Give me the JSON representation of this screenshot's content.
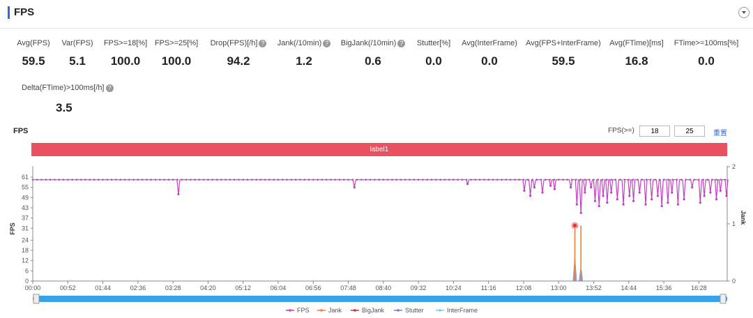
{
  "header": {
    "title": "FPS"
  },
  "stats": [
    {
      "label": "Avg(FPS)",
      "value": "59.5",
      "help": false
    },
    {
      "label": "Var(FPS)",
      "value": "5.1",
      "help": false
    },
    {
      "label": "FPS>=18[%]",
      "value": "100.0",
      "help": false
    },
    {
      "label": "FPS>=25[%]",
      "value": "100.0",
      "help": false
    },
    {
      "label": "Drop(FPS)[/h]",
      "value": "94.2",
      "help": true
    },
    {
      "label": "Jank(/10min)",
      "value": "1.2",
      "help": true
    },
    {
      "label": "BigJank(/10min)",
      "value": "0.6",
      "help": true
    },
    {
      "label": "Stutter[%]",
      "value": "0.0",
      "help": false
    },
    {
      "label": "Avg(InterFrame)",
      "value": "0.0",
      "help": false
    },
    {
      "label": "Avg(FPS+InterFrame)",
      "value": "59.5",
      "help": false
    },
    {
      "label": "Avg(FTime)[ms]",
      "value": "16.8",
      "help": false
    },
    {
      "label": "FTime>=100ms[%]",
      "value": "0.0",
      "help": false
    },
    {
      "label": "Delta(FTime)>100ms[/h]",
      "value": "3.5",
      "help": true
    }
  ],
  "help_glyph": "?",
  "threshold": {
    "label": "FPS(>=)",
    "value1": "18",
    "value2": "25",
    "reset": "重置"
  },
  "label_band": "label1",
  "colors": {
    "fps": "#c23fc2",
    "jank": "#f08030",
    "bigjank": "#c03040",
    "stutter": "#6a86d8",
    "interframe": "#7ec8e8",
    "band": "#e8515f",
    "slider": "#3aa0e8"
  },
  "chart_data": {
    "type": "line",
    "title": "FPS",
    "ylabel": "FPS",
    "y2label": "Jank",
    "ylim": [
      0,
      61
    ],
    "y2lim": [
      0,
      2
    ],
    "yticks": [
      "0",
      "6",
      "12",
      "18",
      "24",
      "31",
      "37",
      "43",
      "49",
      "55",
      "61"
    ],
    "y2ticks": [
      "0",
      "1",
      "2"
    ],
    "xlim_minutes": [
      0,
      1030
    ],
    "xticks": [
      "00:00",
      "00:52",
      "01:44",
      "02:36",
      "03:28",
      "04:20",
      "05:12",
      "06:04",
      "06:56",
      "07:48",
      "08:40",
      "09:32",
      "10:24",
      "11:16",
      "12:08",
      "13:00",
      "13:52",
      "14:44",
      "15:36",
      "16:28"
    ],
    "fps_baseline": 59.5,
    "fps_dips": [
      {
        "x": 3.6,
        "y": 51
      },
      {
        "x": 7.95,
        "y": 55
      },
      {
        "x": 10.75,
        "y": 57
      },
      {
        "x": 12.15,
        "y": 53
      },
      {
        "x": 12.3,
        "y": 50
      },
      {
        "x": 12.4,
        "y": 55
      },
      {
        "x": 12.6,
        "y": 52
      },
      {
        "x": 12.8,
        "y": 56
      },
      {
        "x": 12.9,
        "y": 54
      },
      {
        "x": 13.3,
        "y": 55
      },
      {
        "x": 13.45,
        "y": 45
      },
      {
        "x": 13.55,
        "y": 40
      },
      {
        "x": 13.65,
        "y": 52
      },
      {
        "x": 13.8,
        "y": 55
      },
      {
        "x": 13.9,
        "y": 47
      },
      {
        "x": 14.0,
        "y": 44
      },
      {
        "x": 14.1,
        "y": 50
      },
      {
        "x": 14.2,
        "y": 46
      },
      {
        "x": 14.3,
        "y": 52
      },
      {
        "x": 14.45,
        "y": 48
      },
      {
        "x": 14.6,
        "y": 45
      },
      {
        "x": 14.75,
        "y": 50
      },
      {
        "x": 14.85,
        "y": 47
      },
      {
        "x": 15.0,
        "y": 52
      },
      {
        "x": 15.15,
        "y": 45
      },
      {
        "x": 15.3,
        "y": 48
      },
      {
        "x": 15.45,
        "y": 50
      },
      {
        "x": 15.55,
        "y": 44
      },
      {
        "x": 15.7,
        "y": 46
      },
      {
        "x": 15.8,
        "y": 52
      },
      {
        "x": 15.95,
        "y": 45
      },
      {
        "x": 16.1,
        "y": 48
      },
      {
        "x": 16.3,
        "y": 55
      },
      {
        "x": 16.5,
        "y": 46
      },
      {
        "x": 16.6,
        "y": 50
      },
      {
        "x": 16.75,
        "y": 52
      },
      {
        "x": 16.9,
        "y": 48
      },
      {
        "x": 17.0,
        "y": 53
      },
      {
        "x": 17.15,
        "y": 50
      }
    ],
    "jank_spikes": [
      {
        "x": 13.4,
        "y": 0.97
      },
      {
        "x": 13.55,
        "y": 0.97
      }
    ],
    "stutter_spikes": [
      {
        "x": 13.4,
        "y": 0.5
      },
      {
        "x": 13.55,
        "y": 0.3
      }
    ],
    "jank_marker": {
      "x": 13.4,
      "y": 0.97
    },
    "legend": [
      "FPS",
      "Jank",
      "BigJank",
      "Stutter",
      "InterFrame"
    ],
    "legend_position": "bottom",
    "grid": false
  }
}
